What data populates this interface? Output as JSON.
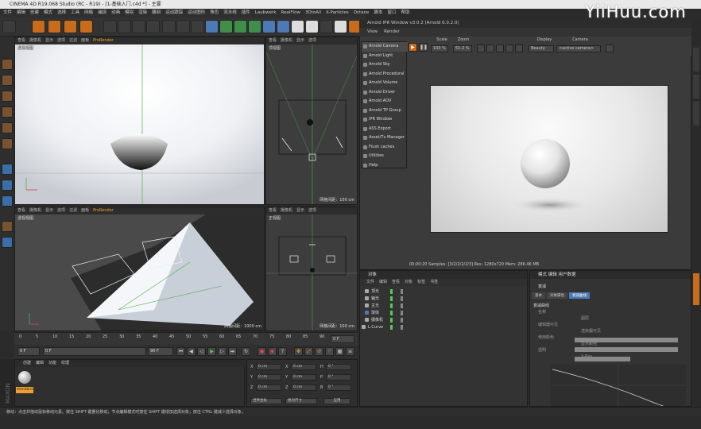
{
  "window": {
    "title": "CINEMA 4D R19.068 Studio (RC - R19) - [1-基础入门.c4d *] - 主要",
    "watermark": "YiiHuu.com"
  },
  "menubar": [
    "文件",
    "编辑",
    "创建",
    "模式",
    "选择",
    "工具",
    "网格",
    "捕捉",
    "动画",
    "模拟",
    "渲染",
    "雕刻",
    "运动跟踪",
    "运动图形",
    "角色",
    "流水线",
    "插件",
    "Laubwerk",
    "RealFlow",
    "3DtoAll",
    "X-Particles",
    "Octane",
    "脚本",
    "窗口",
    "帮助"
  ],
  "viewports": {
    "menu": [
      "查看",
      "摄像机",
      "显示",
      "选项",
      "过滤",
      "面板"
    ],
    "prorender": "ProRender",
    "perspective": {
      "label": "透视视图"
    },
    "top": {
      "label": "顶视图",
      "footer": "网格间距：100 cm"
    },
    "persp2": {
      "label": "透视视图",
      "footer": "网格间距：1000 cm"
    },
    "front": {
      "label": "正视图",
      "footer": "网格间距：100 cm"
    }
  },
  "timeline": {
    "ticks": [
      "0",
      "5",
      "10",
      "15",
      "20",
      "25",
      "30",
      "35",
      "40",
      "45",
      "50",
      "55",
      "60",
      "65",
      "70",
      "75",
      "80",
      "85",
      "90"
    ],
    "frame_indicator": "0 F"
  },
  "playbar": {
    "start": "0 F",
    "start2": "0 F",
    "end": "90 F",
    "end2": "90 F"
  },
  "material": {
    "menu": [
      "创建",
      "编辑",
      "功能",
      "纹理"
    ],
    "mat_name": "standard"
  },
  "coords": {
    "rows": [
      {
        "a": "X",
        "av": "0 cm",
        "b": "X",
        "bv": "0 cm",
        "c": "H",
        "cv": "0 °"
      },
      {
        "a": "Y",
        "av": "0 cm",
        "b": "Y",
        "bv": "0 cm",
        "c": "P",
        "cv": "0 °"
      },
      {
        "a": "Z",
        "av": "0 cm",
        "b": "Z",
        "bv": "0 cm",
        "c": "B",
        "cv": "0 °"
      }
    ],
    "mode1": "世界坐标",
    "mode2": "绝对尺寸",
    "apply": "应用"
  },
  "status": "移动：点击并拖动鼠标移动元素。按住 SHIFT 键量化移动；节点编辑模式时按住 SHIFT 键增加选择对象；按住 CTRL 键减少选择对象。",
  "ipr": {
    "title": "Arnold IPR Window v3.0.2 (Arnold 6.0.2.0)",
    "menu": [
      "View",
      "Render"
    ],
    "scale_label": "Scale",
    "scale_value": "100 %",
    "zoom_label": "Zoom",
    "zoom_value": "51.2 %",
    "display_label": "Display",
    "display_value": "Beauty",
    "camera_label": "Camera",
    "camera_value": "<active camera>",
    "footer": "00:00:20  Samples: [3/2/2/2/2/3]  Res: 1280x720  Mem: 286.46 MB"
  },
  "arnold_menu": [
    "Arnold Camera",
    "Arnold Light",
    "Arnold Sky",
    "Arnold Procedural",
    "Arnold Volume",
    "Arnold Driver",
    "Arnold AOV",
    "Arnold TP Group",
    "IPR Window",
    "ASS Export",
    "Asset/Tx Manager",
    "Flush caches",
    "Utilities",
    "Help"
  ],
  "objects": {
    "title": "对象",
    "menu": [
      "文件",
      "编辑",
      "查看",
      "对象",
      "标签",
      "书签"
    ],
    "rows": [
      "顶光",
      "辅光",
      "主光",
      "球体",
      "摄像机",
      "L.Curve"
    ]
  },
  "attributes": {
    "title": "模式  编辑  用户数据",
    "tabs": [
      "基本",
      "对象属性",
      "衰减曲线"
    ],
    "object_name": "衰减",
    "section": "衰减曲线",
    "fields": [
      "名称",
      "图层",
      "编辑器可见",
      "渲染器可见",
      "使用颜色",
      "显示颜色",
      "透明",
      "X-Ray"
    ]
  }
}
